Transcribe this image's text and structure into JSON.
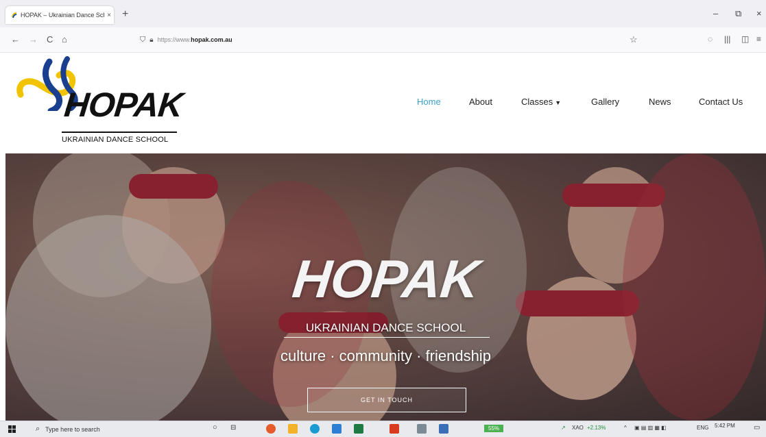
{
  "browser": {
    "tab_title": "HOPAK – Ukrainian Dance Scho",
    "tab_close": "×",
    "new_tab": "+",
    "url_prefix": "https://www.",
    "url_host": "hopak.com.au",
    "window_minimize": "–",
    "window_restore": "⧉",
    "window_close": "×",
    "back": "←",
    "forward": "→",
    "reload": "C",
    "home": "⌂",
    "star": "☆"
  },
  "site": {
    "logo_text": "HOPAK",
    "logo_sub": "UKRAINIAN DANCE SCHOOL",
    "nav": {
      "home": "Home",
      "about": "About",
      "classes": "Classes",
      "gallery": "Gallery",
      "news": "News",
      "contact": "Contact Us"
    },
    "accent_color": "#3da1c8",
    "hero": {
      "title": "HOPAK",
      "subtitle": "UKRAINIAN DANCE SCHOOL",
      "tagline": "culture · community · friendship",
      "cta": "GET IN TOUCH"
    }
  },
  "taskbar": {
    "search_placeholder": "Type here to search",
    "ticker_name": "XAO",
    "ticker_change": "+2.13%",
    "battery": "55%",
    "language": "ENG",
    "time": "5:42 PM"
  }
}
